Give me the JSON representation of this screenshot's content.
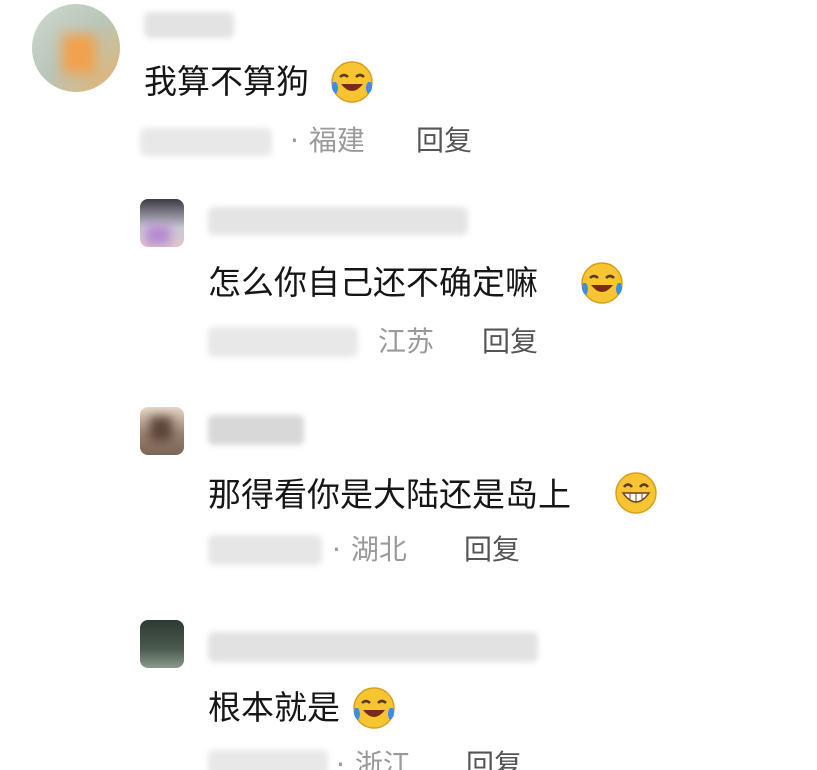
{
  "comments": [
    {
      "text": "我算不算狗",
      "emoji": "laughing-crying-emoji",
      "location": "福建",
      "reply_label": "回复"
    },
    {
      "text": "怎么你自己还不确定嘛",
      "emoji": "laughing-crying-emoji",
      "location": "江苏",
      "reply_label": "回复"
    },
    {
      "text": "那得看你是大陆还是岛上",
      "emoji": "grinning-emoji",
      "location": "湖北",
      "reply_label": "回复"
    },
    {
      "text": "根本就是",
      "emoji": "laughing-crying-emoji",
      "location": "浙江",
      "reply_label": "回复"
    }
  ],
  "colors": {
    "text": "#161616",
    "meta": "#9a9a9a",
    "reply": "#555555",
    "emoji_face": "#f7c531",
    "emoji_tear": "#3a8ee6"
  }
}
